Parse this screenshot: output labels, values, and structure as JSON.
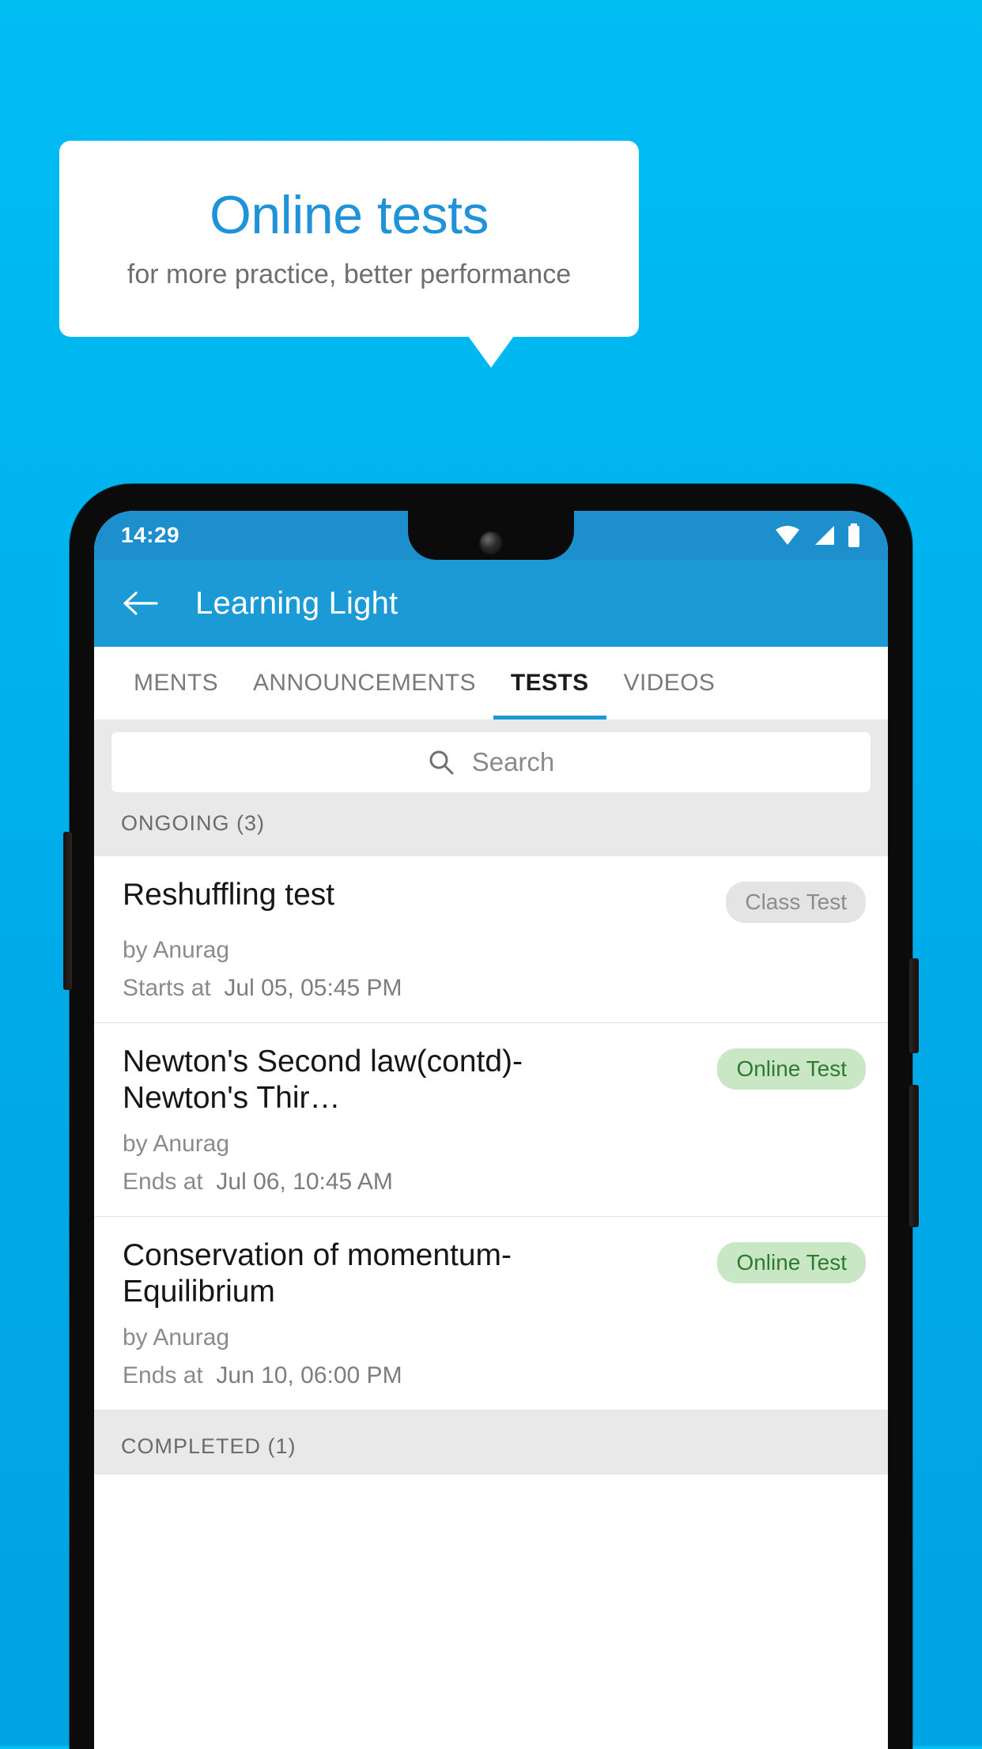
{
  "promo": {
    "title": "Online tests",
    "subtitle": "for more practice, better performance",
    "accent_color": "#1f92D8",
    "background_color": "#00B4EF"
  },
  "phone": {
    "statusbar": {
      "time": "14:29",
      "icons": [
        "wifi-icon",
        "signal-icon",
        "battery-icon"
      ],
      "background_color": "#1C8FCC"
    },
    "toolbar": {
      "back_label": "Back",
      "title": "Learning Light",
      "background_color": "#1C9AD6"
    },
    "tabs": {
      "items": [
        {
          "label": "MENTS",
          "active": false
        },
        {
          "label": "ANNOUNCEMENTS",
          "active": false
        },
        {
          "label": "TESTS",
          "active": true
        },
        {
          "label": "VIDEOS",
          "active": false
        }
      ],
      "indicator_color": "#1C9AD6"
    },
    "search": {
      "placeholder": "Search",
      "value": "",
      "icon": "search-icon"
    },
    "sections": [
      {
        "header": "ONGOING (3)",
        "items": [
          {
            "title": "Reshuffling test",
            "badge": "Class Test",
            "badge_type": "grey",
            "author": "by Anurag",
            "time_label": "Starts at",
            "time_value": "Jul 05, 05:45 PM"
          },
          {
            "title": "Newton's Second law(contd)-Newton's Thir…",
            "badge": "Online Test",
            "badge_type": "green",
            "author": "by Anurag",
            "time_label": "Ends at",
            "time_value": "Jul 06, 10:45 AM"
          },
          {
            "title": "Conservation of momentum-Equilibrium",
            "badge": "Online Test",
            "badge_type": "green",
            "author": "by Anurag",
            "time_label": "Ends at",
            "time_value": "Jun 10, 06:00 PM"
          }
        ]
      },
      {
        "header": "COMPLETED (1)",
        "items": []
      }
    ]
  }
}
